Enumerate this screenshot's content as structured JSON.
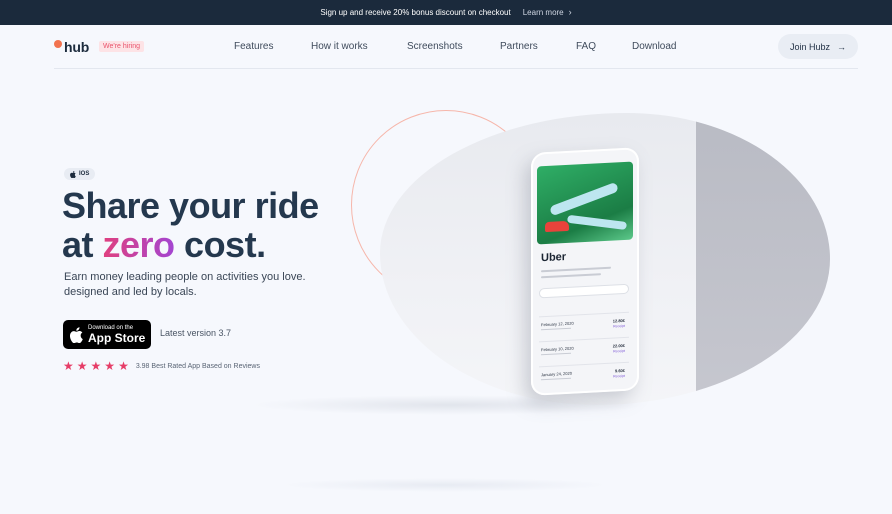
{
  "announcement": {
    "text": "Sign up and receive 20% bonus discount on checkout",
    "link_label": "Learn more"
  },
  "brand": {
    "logo_text": "hub",
    "hiring_badge": "We're hiring",
    "accent_color": "#f2734f"
  },
  "nav": {
    "items": [
      {
        "label": "Features"
      },
      {
        "label": "How it works"
      },
      {
        "label": "Screenshots"
      },
      {
        "label": "Partners"
      },
      {
        "label": "FAQ"
      },
      {
        "label": "Download"
      }
    ],
    "cta_label": "Join Hubz"
  },
  "hero": {
    "platform_badge": "IOS",
    "headline_line1": "Share your ride",
    "headline_prefix": "at ",
    "headline_accent": "zero",
    "headline_suffix": " cost.",
    "subtext_line1": "Earn money leading people on activities you love.",
    "subtext_line2": "designed and led by locals.",
    "appstore_small": "Download on the",
    "appstore_big": "App Store",
    "version_text": "Latest version 3.7",
    "stars": 5,
    "rating_text": "3.98 Best Rated App Based on Reviews"
  },
  "phone": {
    "app_title": "Uber",
    "rows": [
      {
        "date": "February 12, 2020",
        "price": "12.80£",
        "action": "Receipt"
      },
      {
        "date": "February 10, 2020",
        "price": "22.00£",
        "action": "Receipt"
      },
      {
        "date": "January 24, 2020",
        "price": "9.60£",
        "action": "Receipt"
      }
    ]
  },
  "colors": {
    "topbar_bg": "#1b2a3c",
    "headline": "#24384e",
    "accent_gradient_start": "#e0407f",
    "accent_gradient_end": "#a345d2",
    "star": "#e63d67"
  }
}
